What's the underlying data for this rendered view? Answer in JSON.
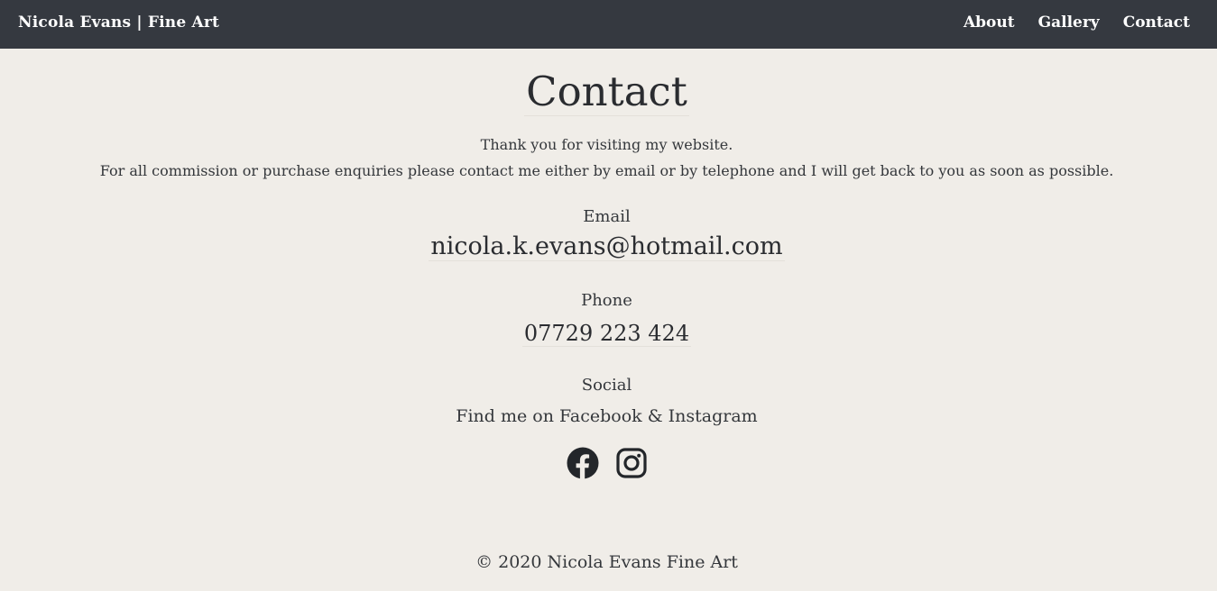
{
  "nav": {
    "brand": "Nicola Evans | Fine Art",
    "links": [
      {
        "label": "About"
      },
      {
        "label": "Gallery"
      },
      {
        "label": "Contact"
      }
    ]
  },
  "page": {
    "title": "Contact",
    "intro_line1": "Thank you for visiting my website.",
    "intro_line2": "For all commission or purchase enquiries please contact me either by email or by telephone and I will get back to you as soon as possible."
  },
  "contact": {
    "email_label": "Email",
    "email_value": "nicola.k.evans@hotmail.com",
    "phone_label": "Phone",
    "phone_value": "07729 223 424",
    "social_label": "Social",
    "social_text": "Find me on Facebook & Instagram"
  },
  "social_icons": [
    "facebook-icon",
    "instagram-icon"
  ],
  "footer": {
    "copyright": "© 2020 Nicola Evans Fine Art"
  },
  "colors": {
    "navbar_bg": "#353940",
    "page_bg": "#f0ede8",
    "text": "#2f3236"
  }
}
